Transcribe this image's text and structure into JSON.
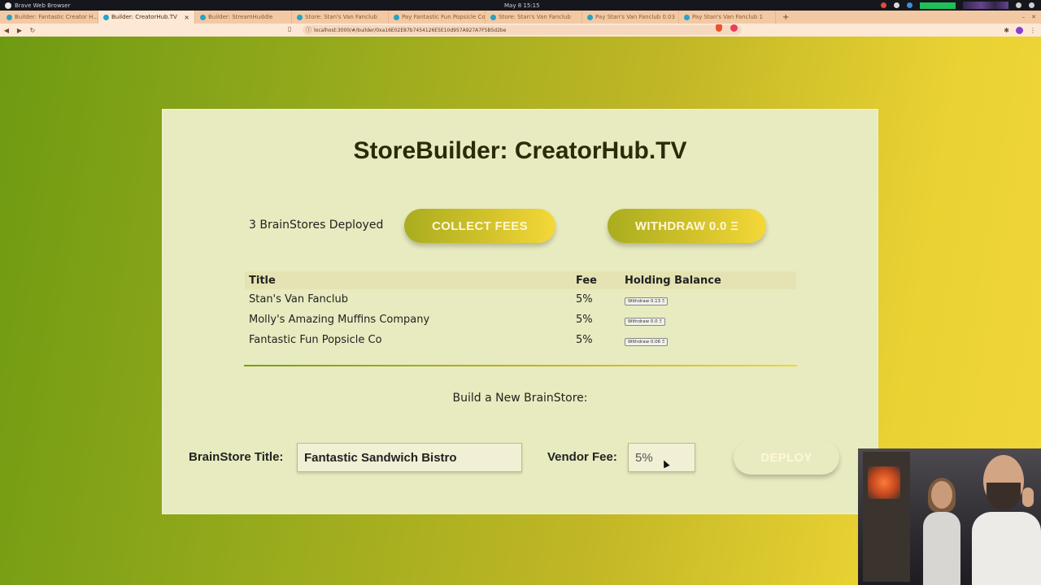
{
  "os": {
    "browser_menu": "Brave Web Browser",
    "clock": "May 8  15:15"
  },
  "browser": {
    "tabs": [
      {
        "label": "Builder: Fantastic Creator H..."
      },
      {
        "label": "Builder: CreatorHub.TV"
      },
      {
        "label": "Builder: StreamHuddle"
      },
      {
        "label": "Store: Stan's Van Fanclub"
      },
      {
        "label": "Pay Fantastic Fun Popsicle Co"
      },
      {
        "label": "Store: Stan's Van Fanclub"
      },
      {
        "label": "Pay Stan's Van Fanclub 0.03"
      },
      {
        "label": "Pay Stan's Van Fanclub 1"
      }
    ],
    "new_tab": "+",
    "url": "localhost:3000/#/builder/0xa16E02E87b7454126E5E10d957A927A7F5B5d2be"
  },
  "page": {
    "title": "StoreBuilder: CreatorHub.TV",
    "deployed_text": "3 BrainStores Deployed",
    "collect_fees_label": "COLLECT FEES",
    "withdraw_label": "WITHDRAW 0.0 Ξ",
    "table": {
      "headers": {
        "title": "Title",
        "fee": "Fee",
        "balance": "Holding Balance"
      },
      "rows": [
        {
          "title": "Stan's Van Fanclub",
          "fee": "5%",
          "withdraw": "Withdraw 0.13 Ξ"
        },
        {
          "title": "Molly's Amazing Muffins Company",
          "fee": "5%",
          "withdraw": "Withdraw 0.0 Ξ"
        },
        {
          "title": "Fantastic Fun Popsicle Co",
          "fee": "5%",
          "withdraw": "Withdraw 0.06 Ξ"
        }
      ]
    },
    "build_label": "Build a New BrainStore:",
    "form": {
      "title_label": "BrainStore Title:",
      "title_value": "Fantastic Sandwich Bistro",
      "fee_label": "Vendor Fee:",
      "fee_value": "5%",
      "deploy_label": "DEPLOY"
    }
  },
  "colors": {
    "gradient_start": "#6e9a12",
    "gradient_end": "#f2d63a",
    "card_bg": "#e8ebbf",
    "tab_strip": "#f3c9a4"
  }
}
